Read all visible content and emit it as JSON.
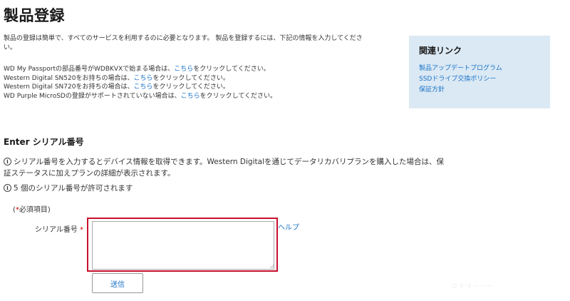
{
  "page": {
    "title": "製品登録"
  },
  "intro": {
    "line1": "製品の登録は簡単で、すべてのサービスを利用するのに必要となります。 製品を登録するには、下記の情報を入力してくださ",
    "line2": "い。",
    "rows": [
      {
        "before": "WD My Passportの部品番号がWDBKVXで始まる場合は、",
        "link": "こちら",
        "after": "をクリックしてください。"
      },
      {
        "before": "Western Digital SN520をお持ちの場合は、",
        "link": "こちら",
        "after": "をクリックしてください。"
      },
      {
        "before": "Western Digital SN720をお持ちの場合は、",
        "link": "こちら",
        "after": "をクリックしてください。"
      },
      {
        "before": "WD Purple MicroSDの登録がサポートされていない場合は、",
        "link": "こちら",
        "after": "をクリックしてください。"
      }
    ]
  },
  "related": {
    "title": "関連リンク",
    "links": [
      "製品アップデートプログラム",
      "SSDドライブ交換ポリシー",
      "保証方針"
    ]
  },
  "section": {
    "title": "Enter シリアル番号",
    "info1": "シリアル番号を入力するとデバイス情報を取得できます。Western Digitalを通じてデータリカバリプランを購入した場合は、保",
    "info1b": "証ステータスに加えプランの詳細が表示されます。",
    "info2": "5 個のシリアル番号が許可されます",
    "info_icon_glyph": "i"
  },
  "form": {
    "required_open": "(",
    "required_star": "*",
    "required_text": "必須項目)",
    "serial_label": "シリアル番号",
    "serial_star": "*",
    "serial_value": "",
    "help_label": "ヘルプ",
    "submit_label": "送信"
  },
  "colors": {
    "link": "#1a73c8",
    "highlight_border": "#c8102e",
    "sidebar_bg": "#dbe9f4",
    "required": "#cc0000"
  },
  "icons": {
    "info": "info-circle-icon",
    "resize": "resize-grip-icon"
  }
}
